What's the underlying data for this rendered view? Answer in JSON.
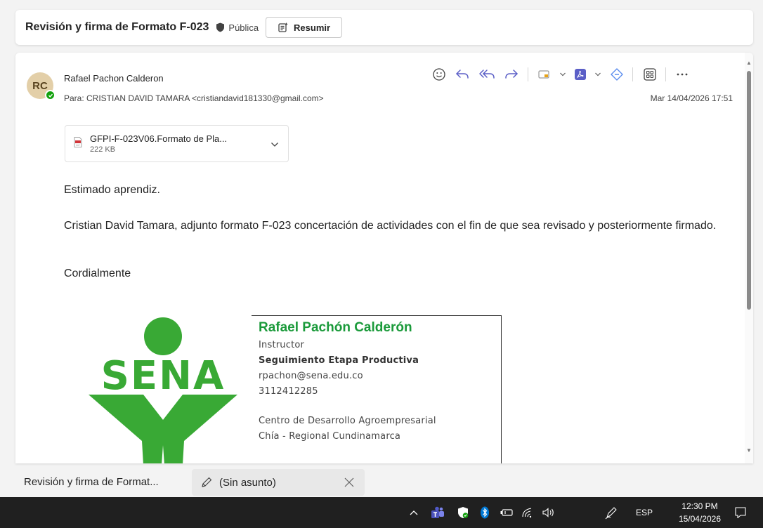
{
  "header": {
    "subject": "Revisión y firma de Formato F-023",
    "sensitivity": "Pública",
    "summarize_label": "Resumir"
  },
  "message": {
    "avatar_initials": "RC",
    "sender_name": "Rafael Pachon Calderon",
    "recipient_line": "Para:  CRISTIAN DAVID TAMARA <cristiandavid181330@gmail.com>",
    "date": "Mar 14/04/2026 17:51",
    "attachment": {
      "name": "GFPI-F-023V06.Formato de Pla...",
      "size": "222 KB"
    },
    "body": {
      "greeting": "Estimado aprendiz.",
      "paragraph": "Cristian David Tamara, adjunto formato F-023 concertación de actividades con el fin de que sea revisado y posteriormente firmado.",
      "closing": "Cordialmente"
    },
    "signature": {
      "logo_text": "SENA",
      "name": "Rafael Pachón Calderón",
      "role": "Instructor",
      "area": "Seguimiento Etapa Productiva",
      "email": "rpachon@sena.edu.co",
      "phone": "3112412285",
      "center": "Centro de Desarrollo Agroempresarial",
      "region": "Chía - Regional Cundinamarca"
    }
  },
  "toolbar": {
    "icons": [
      "emoji-icon",
      "reply-icon",
      "reply-all-icon",
      "forward-icon",
      "tag-icon",
      "acrobat-icon",
      "link-icon",
      "apps-icon",
      "more-icon"
    ]
  },
  "tabs": [
    {
      "label": "Revisión y firma de Format..."
    },
    {
      "label": "(Sin asunto)"
    }
  ],
  "taskbar": {
    "language": "ESP",
    "time": "12:30 PM",
    "date": "15/04/2026"
  },
  "colors": {
    "sena_green": "#39a935",
    "signature_name": "#1a9a3a",
    "accent_purple": "#5b5fc7",
    "taskbar_bg": "#202020"
  }
}
